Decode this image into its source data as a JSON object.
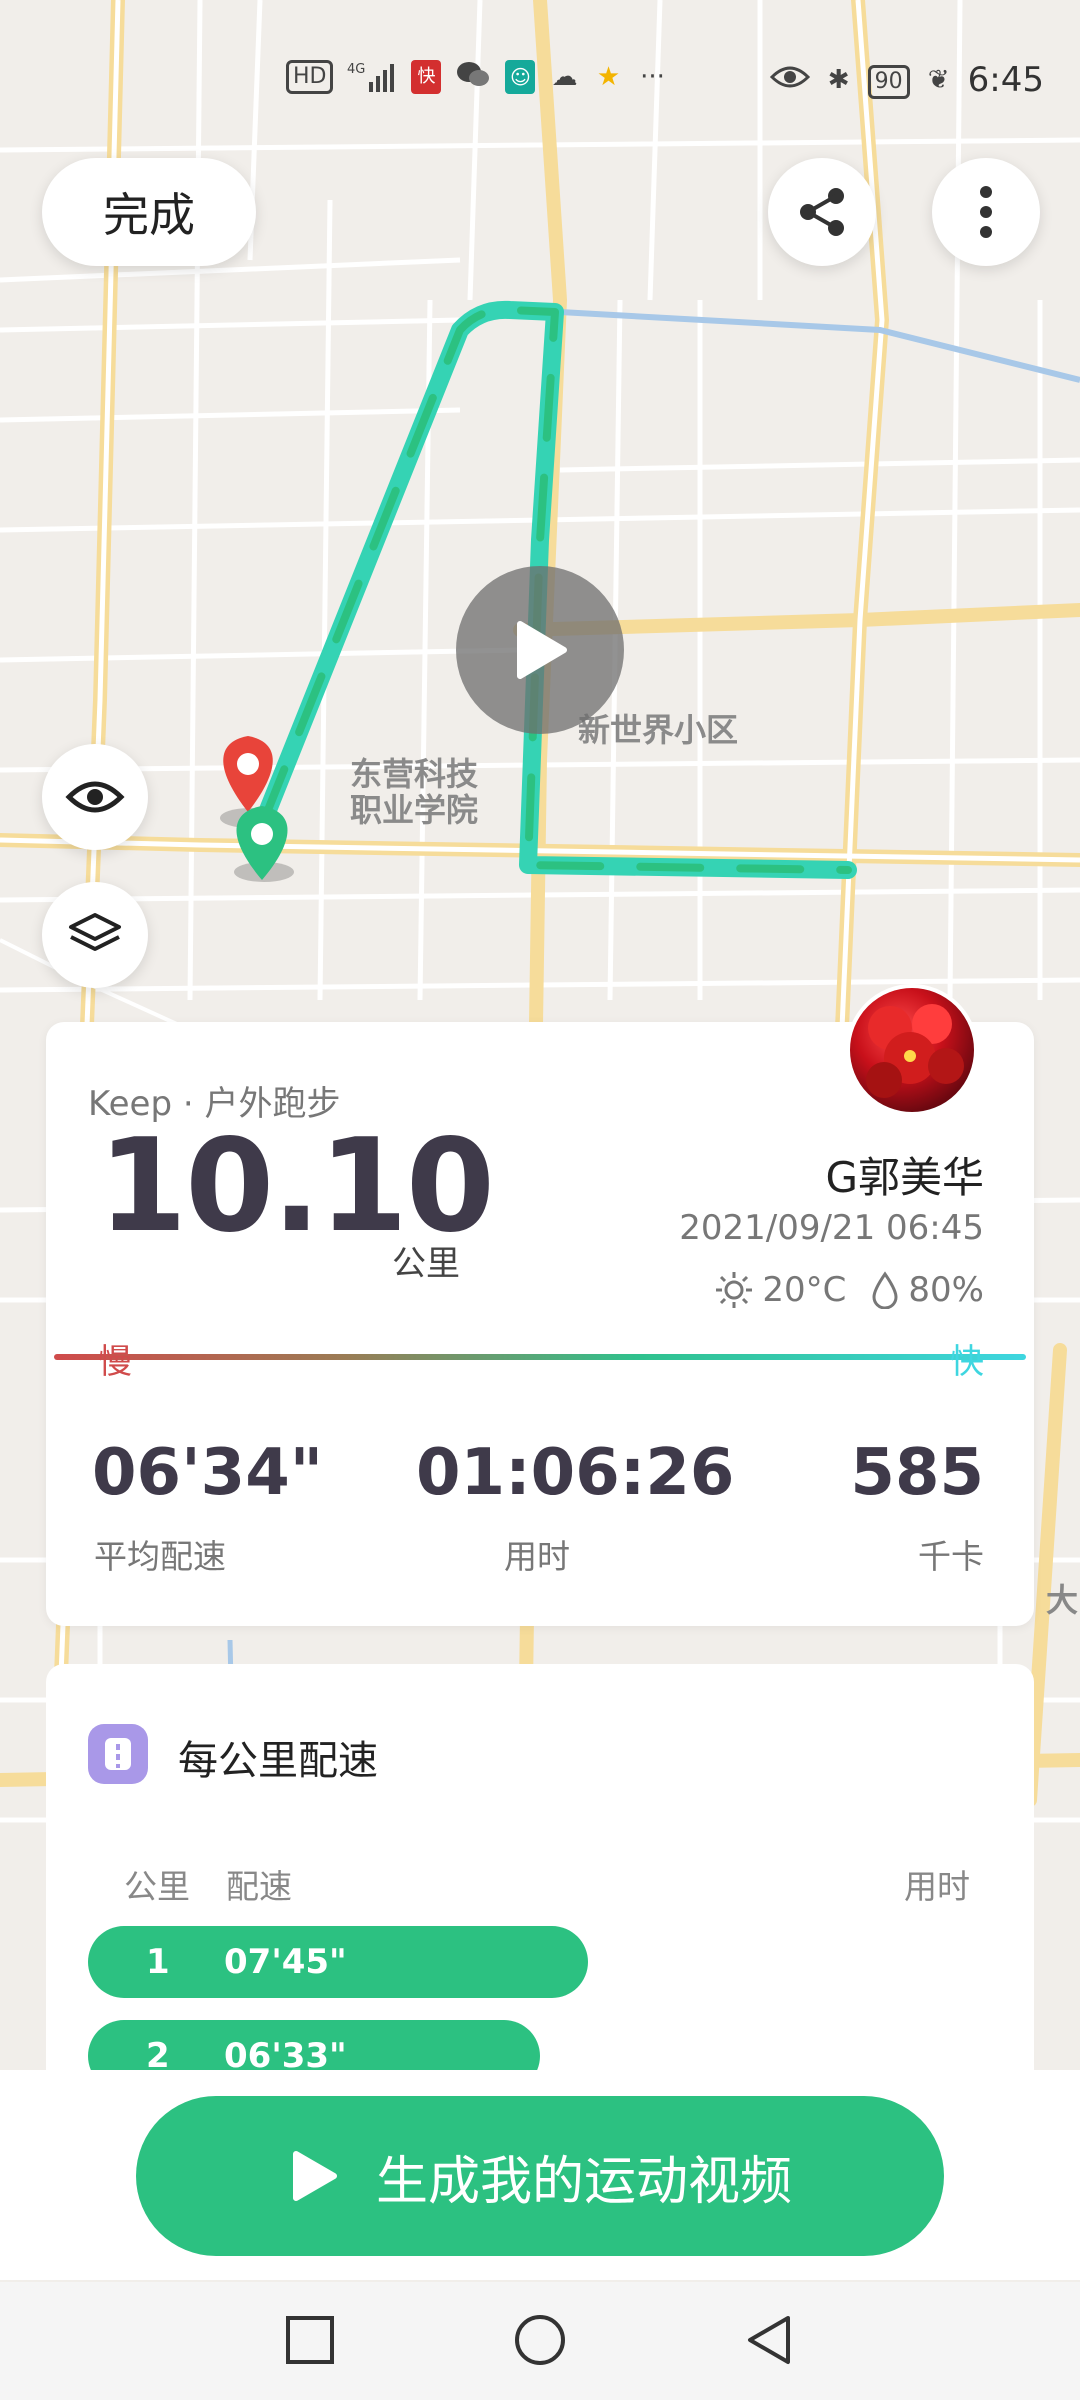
{
  "status_bar": {
    "left_icons": [
      "hd-icon",
      "4g-signal-icon",
      "news-app-icon",
      "wechat-icon",
      "mi-icon",
      "cloud-icon",
      "star-icon",
      "more-icon"
    ],
    "hd_label": "HD",
    "signal_label": "4G",
    "battery": "90",
    "time": "6:45"
  },
  "top": {
    "done_label": "完成"
  },
  "map": {
    "label_college": "东营科技\n职业学院",
    "label_college_line1": "东营科技",
    "label_college_line2": "职业学院",
    "label_community": "新世界小区",
    "label_edge": "大"
  },
  "summary": {
    "source": "Keep · 户外跑步",
    "distance": "10.10",
    "distance_unit": "公里",
    "user_name": "G郭美华",
    "datetime": "2021/09/21 06:45",
    "temperature": "20°C",
    "humidity": "80%",
    "slow_label": "慢",
    "fast_label": "快",
    "avg_pace": "06'34\"",
    "avg_pace_label": "平均配速",
    "duration": "01:06:26",
    "duration_label": "用时",
    "calories": "585",
    "calories_label": "千卡"
  },
  "pace": {
    "title": "每公里配速",
    "col_km": "公里",
    "col_pace": "配速",
    "col_time": "用时",
    "rows": [
      {
        "km": "1",
        "pace": "07'45\""
      },
      {
        "km": "2",
        "pace": "06'33\""
      }
    ]
  },
  "generate_button": "生成我的运动视频",
  "colors": {
    "accent_green": "#2cc181",
    "slow_red": "#d04b4b",
    "fast_cyan": "#3ed6e0",
    "pace_icon": "#a998e8"
  }
}
